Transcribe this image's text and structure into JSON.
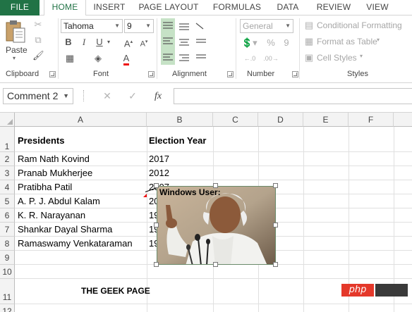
{
  "ribbon_tabs": [
    "FILE",
    "HOME",
    "INSERT",
    "PAGE LAYOUT",
    "FORMULAS",
    "DATA",
    "REVIEW",
    "VIEW"
  ],
  "active_tab": "HOME",
  "clipboard": {
    "paste_label": "Paste",
    "group_label": "Clipboard"
  },
  "font": {
    "name": "Tahoma",
    "size": "9",
    "group_label": "Font"
  },
  "alignment": {
    "group_label": "Alignment"
  },
  "number": {
    "format": "General",
    "group_label": "Number",
    "percent": "%",
    "comma": "9"
  },
  "styles": {
    "conditional": "Conditional Formatting",
    "format_table": "Format as Table",
    "cell_styles": "Cell Styles",
    "group_label": "Styles"
  },
  "formula_bar": {
    "name_box": "Comment 2",
    "fx": "fx",
    "value": ""
  },
  "columns": [
    "A",
    "B",
    "C",
    "D",
    "E",
    "F"
  ],
  "rows": [
    "1",
    "2",
    "3",
    "4",
    "5",
    "6",
    "7",
    "8",
    "9",
    "10",
    "11",
    "12"
  ],
  "cells": {
    "A1": "Presidents",
    "B1": "Election Year",
    "A2": "Ram Nath Kovind",
    "B2": "2017",
    "A3": "Pranab Mukherjee",
    "B3": "2012",
    "A4": "Pratibha Patil",
    "B4": "2007",
    "A5": "A. P. J. Abdul Kalam",
    "B5": "20",
    "A6": "K. R. Narayanan",
    "B6": "19",
    "A7": "Shankar Dayal Sharma",
    "B7": "19",
    "A8": "Ramaswamy Venkataraman",
    "B8": "19",
    "A11": "THE GEEK PAGE"
  },
  "comment": {
    "author": "Windows User:"
  },
  "watermark": {
    "logo": "php",
    "site": ""
  },
  "colors": {
    "file_tab": "#217346",
    "accent": "#217346",
    "comment_marker": "#e11111"
  }
}
